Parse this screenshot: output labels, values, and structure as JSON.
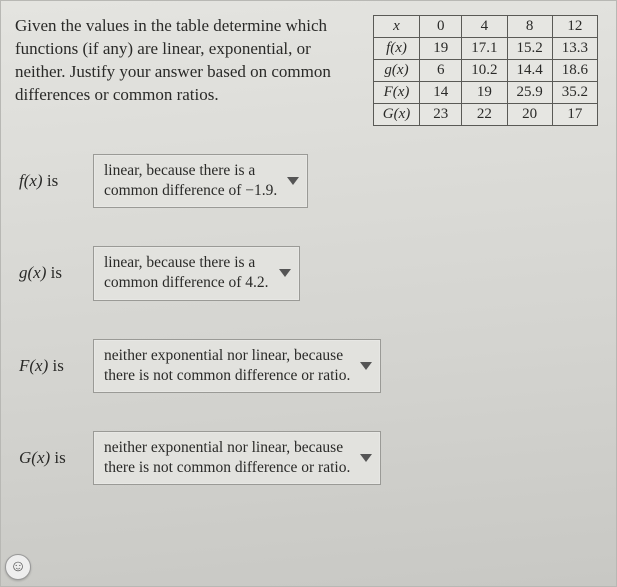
{
  "prompt": "Given the values in the table determine which functions (if any) are linear, exponential, or neither. Justify your answer based on common differences or common ratios.",
  "table": {
    "header_var": "x",
    "x": [
      "0",
      "4",
      "8",
      "12"
    ],
    "rows": [
      {
        "label": "f(x)",
        "cells": [
          "19",
          "17.1",
          "15.2",
          "13.3"
        ]
      },
      {
        "label": "g(x)",
        "cells": [
          "6",
          "10.2",
          "14.4",
          "18.6"
        ]
      },
      {
        "label": "F(x)",
        "cells": [
          "14",
          "19",
          "25.9",
          "35.2"
        ]
      },
      {
        "label": "G(x)",
        "cells": [
          "23",
          "22",
          "20",
          "17"
        ]
      }
    ]
  },
  "answers": [
    {
      "fn": "f(x)",
      "is": "is",
      "choice_l1": "linear, because there is a",
      "choice_l2": "common difference of −1.9."
    },
    {
      "fn": "g(x)",
      "is": "is",
      "choice_l1": "linear, because there is a",
      "choice_l2": "common difference of 4.2."
    },
    {
      "fn": "F(x)",
      "is": "is",
      "choice_l1": "neither exponential nor linear, because",
      "choice_l2": "there is not common difference or ratio."
    },
    {
      "fn": "G(x)",
      "is": "is",
      "choice_l1": "neither exponential nor linear, because",
      "choice_l2": "there is not common difference or ratio."
    }
  ],
  "help_icon": "☺"
}
